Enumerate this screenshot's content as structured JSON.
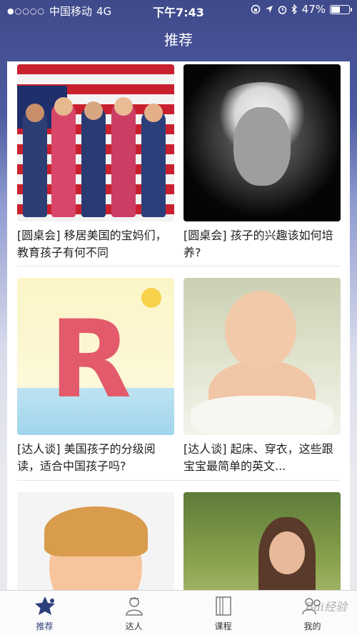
{
  "status_bar": {
    "signal": "●○○○○",
    "carrier": "中国移动",
    "network": "4G",
    "time": "下午7:43",
    "battery": "47%"
  },
  "nav": {
    "title": "推荐"
  },
  "cards": [
    {
      "caption": "[圆桌会] 移居美国的宝妈们，教育孩子有何不同",
      "image": "children-with-american-flag"
    },
    {
      "caption": "[圆桌会] 孩子的兴趣该如何培养?",
      "image": "einstein-portrait"
    },
    {
      "caption": "[达人谈] 美国孩子的分级阅读，适合中国孩子吗?",
      "image": "cartoon-letter-r"
    },
    {
      "caption": "[达人谈] 起床、穿衣，这些跟宝宝最简单的英文...",
      "image": "crying-baby"
    },
    {
      "caption": "",
      "image": "smiling-girl-painted-hands"
    },
    {
      "caption": "",
      "image": "mother-child-forest"
    }
  ],
  "tab_bar": {
    "tabs": [
      {
        "label": "推荐",
        "icon": "star-icon",
        "active": true
      },
      {
        "label": "达人",
        "icon": "person-icon",
        "active": false
      },
      {
        "label": "课程",
        "icon": "book-icon",
        "active": false
      },
      {
        "label": "我的",
        "icon": "user-group-icon",
        "active": false
      }
    ]
  },
  "watermark": "Bai经验"
}
